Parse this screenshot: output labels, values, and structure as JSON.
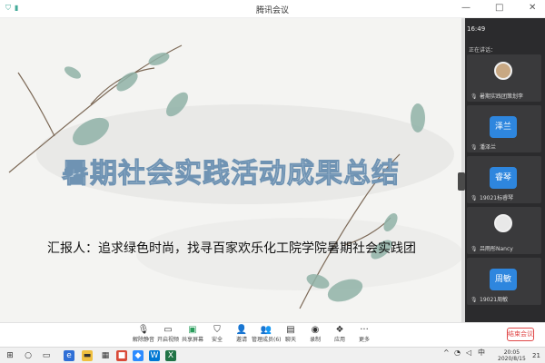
{
  "window": {
    "title": "腾讯会议",
    "time": "16:49",
    "controls": [
      "—",
      "□",
      "✕"
    ]
  },
  "slide": {
    "title": "暑期社会实践活动成果总结",
    "reporter": "汇报人：追求绿色时尚，找寻百家欢乐化工院学院暑期社会实践团"
  },
  "panel": {
    "speaking_label": "正在讲话：",
    "participants": [
      {
        "name": "暑期实践团策划李",
        "badge": "",
        "avatar": true
      },
      {
        "name": "潘泽兰",
        "badge": "泽兰"
      },
      {
        "name": "19021标睿琴",
        "badge": "睿琴"
      },
      {
        "name": "吕雨彤Nancy",
        "badge": "",
        "avatar": true
      },
      {
        "name": "19021周敏",
        "badge": "周敏"
      }
    ]
  },
  "toolbar": {
    "items": [
      {
        "label": "解除静音",
        "icon": "mic-icon"
      },
      {
        "label": "开启视频",
        "icon": "camera-icon"
      },
      {
        "label": "共享屏幕",
        "icon": "screen-share-icon"
      },
      {
        "label": "安全",
        "icon": "shield-icon"
      },
      {
        "label": "邀请",
        "icon": "invite-icon"
      },
      {
        "label": "管理成员(6)",
        "icon": "members-icon"
      },
      {
        "label": "聊天",
        "icon": "chat-icon"
      },
      {
        "label": "录制",
        "icon": "record-icon"
      },
      {
        "label": "应用",
        "icon": "apps-icon"
      },
      {
        "label": "更多",
        "icon": "more-icon"
      }
    ],
    "end_label": "结束会议"
  },
  "taskbar": {
    "clock_time": "20:05",
    "clock_date": "2020/8/15",
    "lang": "中",
    "notif": "21"
  }
}
